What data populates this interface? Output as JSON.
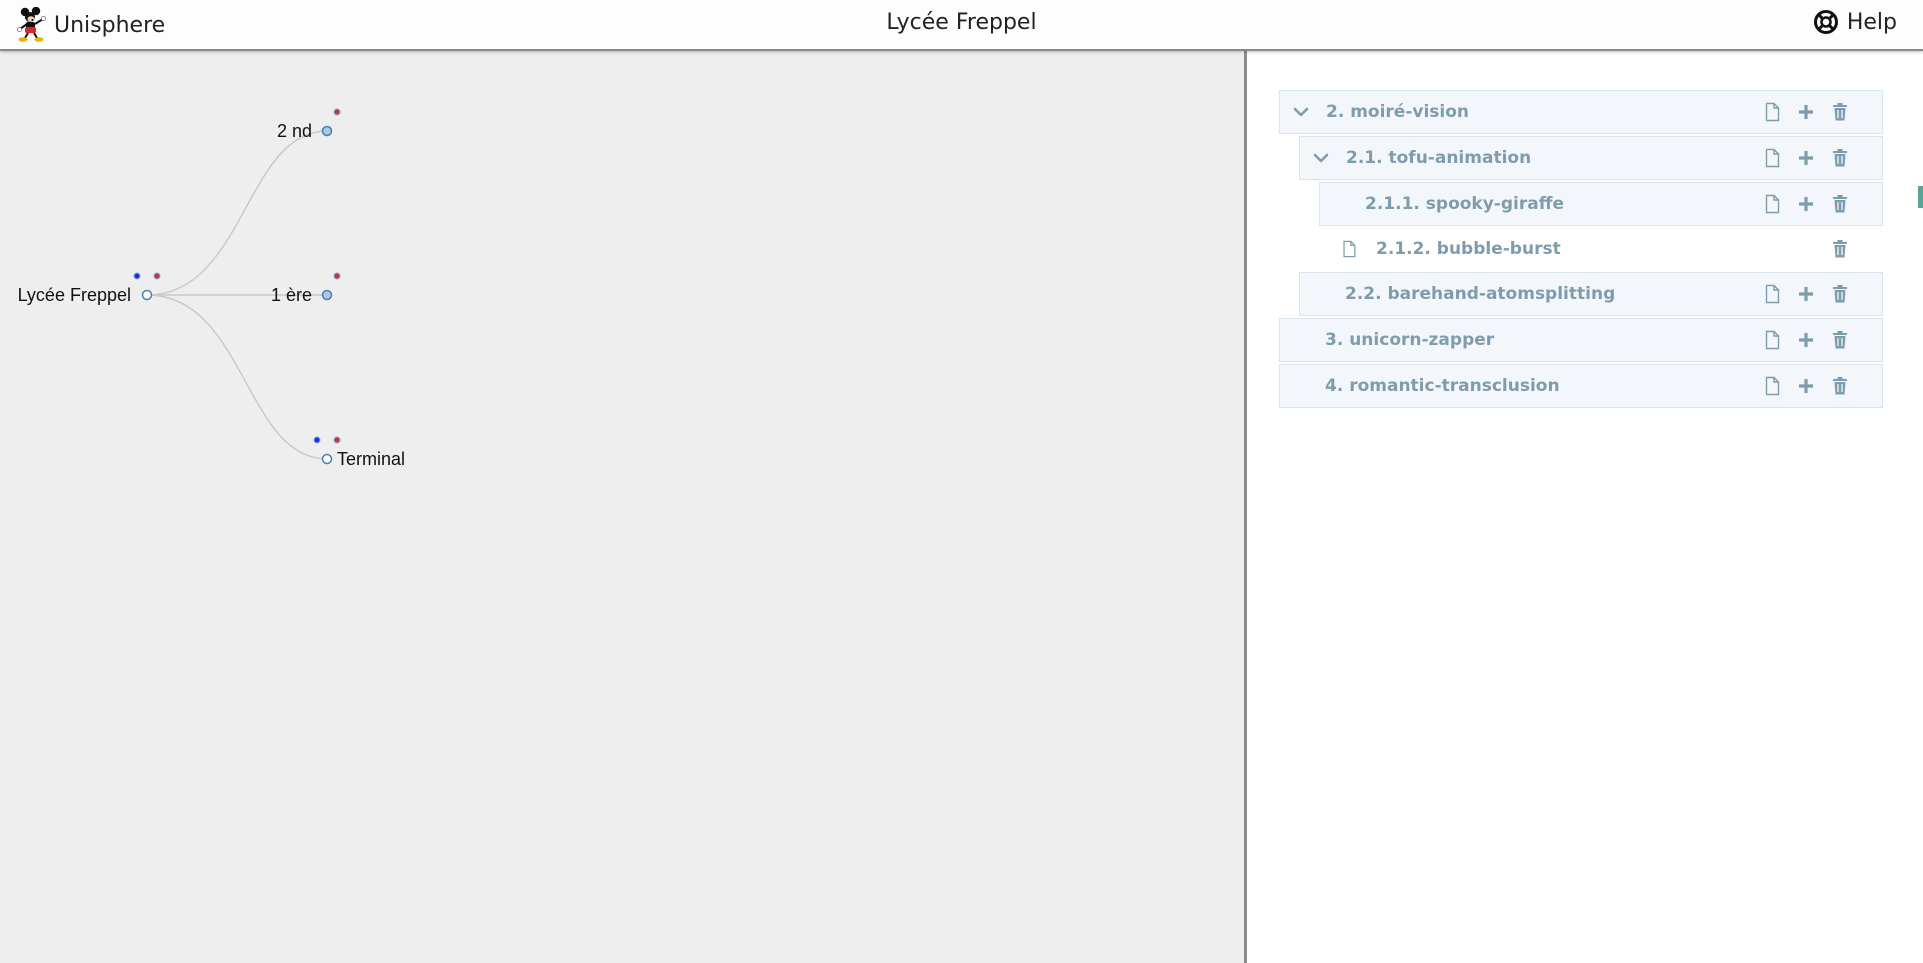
{
  "header": {
    "app_name": "Unisphere",
    "page_title": "Lycée Freppel",
    "help_label": "Help",
    "logo_icon": "mickey-mouse-logo",
    "help_icon": "lifebuoy-icon"
  },
  "graph": {
    "root": "Lycée Freppel",
    "children": [
      "2 nd",
      "1 ère",
      "Terminal"
    ],
    "colors": {
      "edge": "#c8c8c8",
      "node_fill": "#a9c9e8",
      "node_stroke": "#4a7fb0",
      "dot_blue": "#1a2ee8",
      "dot_red": "#c0334a"
    }
  },
  "tree": {
    "items": [
      {
        "label": "2. moiré-vision",
        "expanded": true,
        "actions": [
          "document-icon",
          "plus-icon",
          "trash-icon"
        ]
      },
      {
        "label": "2.1. tofu-animation",
        "expanded": true,
        "actions": [
          "document-icon",
          "plus-icon",
          "trash-icon"
        ]
      },
      {
        "label": "2.1.1. spooky-giraffe",
        "actions": [
          "document-icon",
          "plus-icon",
          "trash-icon"
        ]
      },
      {
        "label": "2.1.2. bubble-burst",
        "leaf": true,
        "actions": [
          "trash-icon"
        ]
      },
      {
        "label": "2.2. barehand-atomsplitting",
        "actions": [
          "document-icon",
          "plus-icon",
          "trash-icon"
        ]
      },
      {
        "label": "3. unicorn-zapper",
        "actions": [
          "document-icon",
          "plus-icon",
          "trash-icon"
        ]
      },
      {
        "label": "4. romantic-transclusion",
        "actions": [
          "document-icon",
          "plus-icon",
          "trash-icon"
        ]
      }
    ],
    "colors": {
      "label": "#7f9cad",
      "icon": "#7f9cad",
      "row_bg": "#f3f7fb",
      "row_border": "#d8e4ee"
    }
  }
}
